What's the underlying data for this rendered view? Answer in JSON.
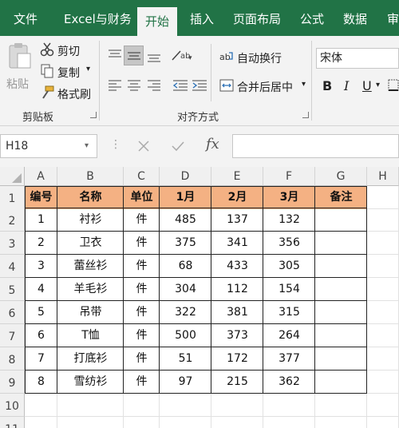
{
  "ribbon_tabs": [
    "文件",
    "Excel与财务",
    "开始",
    "插入",
    "页面布局",
    "公式",
    "数据",
    "审"
  ],
  "clipboard": {
    "paste": "粘贴",
    "cut": "剪切",
    "copy": "复制",
    "format_painter": "格式刷",
    "group_label": "剪贴板"
  },
  "alignment": {
    "wrap_text": "自动换行",
    "merge_center": "合并后居中",
    "group_label": "对齐方式"
  },
  "font": {
    "name": "宋体",
    "bold": "B",
    "italic": "I",
    "underline": "U"
  },
  "formula_bar": {
    "name_box": "H18",
    "fx": "fx",
    "formula": ""
  },
  "columns": [
    "A",
    "B",
    "C",
    "D",
    "E",
    "F",
    "G",
    "H"
  ],
  "rows": [
    "1",
    "2",
    "3",
    "4",
    "5",
    "6",
    "7",
    "8",
    "9",
    "10",
    "11"
  ],
  "table": {
    "headers": [
      "编号",
      "名称",
      "单位",
      "1月",
      "2月",
      "3月",
      "备注"
    ],
    "rows": [
      [
        "1",
        "衬衫",
        "件",
        "485",
        "137",
        "132",
        ""
      ],
      [
        "2",
        "卫衣",
        "件",
        "375",
        "341",
        "356",
        ""
      ],
      [
        "3",
        "蕾丝衫",
        "件",
        "68",
        "433",
        "305",
        ""
      ],
      [
        "4",
        "羊毛衫",
        "件",
        "304",
        "112",
        "154",
        ""
      ],
      [
        "5",
        "吊带",
        "件",
        "322",
        "381",
        "315",
        ""
      ],
      [
        "6",
        "T恤",
        "件",
        "500",
        "373",
        "264",
        ""
      ],
      [
        "7",
        "打底衫",
        "件",
        "51",
        "172",
        "377",
        ""
      ],
      [
        "8",
        "雪纺衫",
        "件",
        "97",
        "215",
        "362",
        ""
      ]
    ]
  },
  "colors": {
    "accent": "#217346",
    "header_fill": "#f4b183"
  }
}
